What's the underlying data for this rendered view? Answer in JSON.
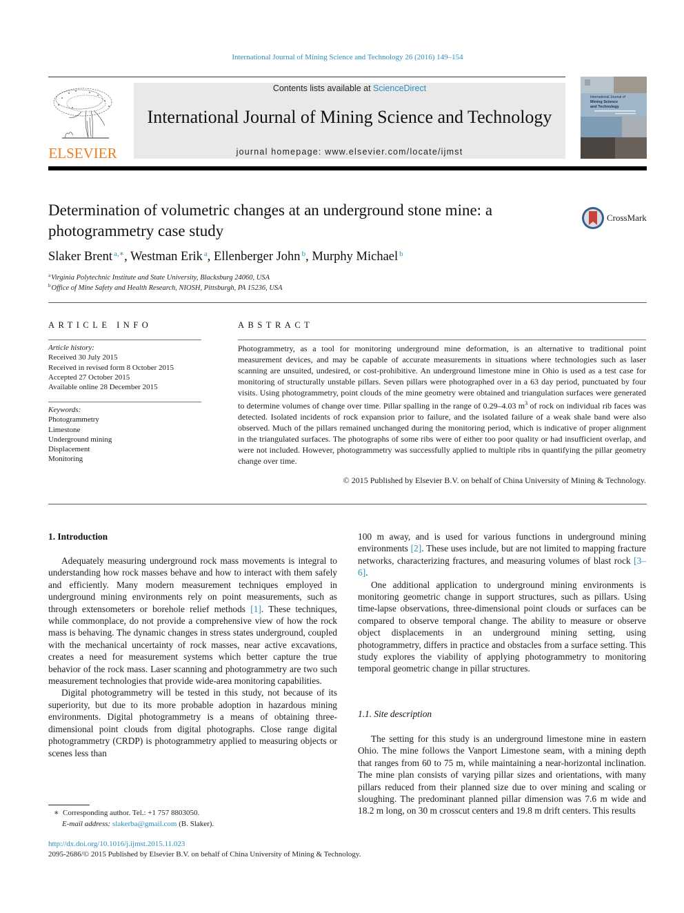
{
  "header": {
    "running_head": "International Journal of Mining Science and Technology 26 (2016) 149–154",
    "publisher": "ELSEVIER",
    "contents_prefix": "Contents lists available at ",
    "contents_link": "ScienceDirect",
    "journal_title": "International Journal of Mining Science and Technology",
    "homepage": "journal homepage: www.elsevier.com/locate/ijmst",
    "cover_title_lines": [
      "International Journal of",
      "Mining Science",
      "and Technology"
    ]
  },
  "article": {
    "title_line1": "Determination of volumetric changes at an underground stone mine: a",
    "title_line2": "photogrammetry case study",
    "crossmark_label": "CrossMark",
    "authors": [
      {
        "name": "Slaker Brent",
        "sup": "a,∗",
        "sep": ", "
      },
      {
        "name": "Westman Erik",
        "sup": "a",
        "sep": ", "
      },
      {
        "name": "Ellenberger John",
        "sup": "b",
        "sep": ", "
      },
      {
        "name": "Murphy Michael",
        "sup": "b",
        "sep": ""
      }
    ],
    "affiliations": [
      {
        "mark": "a",
        "text": "Virginia Polytechnic Institute and State University, Blacksburg 24060, USA"
      },
      {
        "mark": "b",
        "text": "Office of Mine Safety and Health Research, NIOSH, Pittsburgh, PA 15236, USA"
      }
    ]
  },
  "article_info": {
    "heading": "ARTICLE INFO",
    "history_label": "Article history:",
    "history": [
      "Received 30 July 2015",
      "Received in revised form 8 October 2015",
      "Accepted 27 October 2015",
      "Available online 28 December 2015"
    ],
    "keywords_label": "Keywords:",
    "keywords": [
      "Photogrammetry",
      "Limestone",
      "Underground mining",
      "Displacement",
      "Monitoring"
    ]
  },
  "abstract": {
    "heading": "ABSTRACT",
    "text_before_sup": "Photogrammetry, as a tool for monitoring underground mine deformation, is an alternative to traditional point measurement devices, and may be capable of accurate measurements in situations where technologies such as laser scanning are unsuited, undesired, or cost-prohibitive. An underground limestone mine in Ohio is used as a test case for monitoring of structurally unstable pillars. Seven pillars were photographed over in a 63 day period, punctuated by four visits. Using photogrammetry, point clouds of the mine geometry were obtained and triangulation surfaces were generated to determine volumes of change over time. Pillar spalling in the range of 0.29–4.03 m",
    "sup": "3",
    "text_after_sup": " of rock on individual rib faces was detected. Isolated incidents of rock expansion prior to failure, and the isolated failure of a weak shale band were also observed. Much of the pillars remained unchanged during the monitoring period, which is indicative of proper alignment in the triangulated surfaces. The photographs of some ribs were of either too poor quality or had insufficient overlap, and were not included. However, photogrammetry was successfully applied to multiple ribs in quantifying the pillar geometry change over time.",
    "copyright": "© 2015 Published by Elsevier B.V. on behalf of China University of Mining & Technology."
  },
  "body": {
    "section1_heading": "1. Introduction",
    "p1_a": "Adequately measuring underground rock mass movements is integral to understanding how rock masses behave and how to interact with them safely and efficiently. Many modern measurement techniques employed in underground mining environments rely on point measurements, such as through extensometers or borehole relief methods ",
    "p1_ref": "[1]",
    "p1_b": ". These techniques, while commonplace, do not provide a comprehensive view of how the rock mass is behaving. The dynamic changes in stress states underground, coupled with the mechanical uncertainty of rock masses, near active excavations, creates a need for measurement systems which better capture the true behavior of the rock mass. Laser scanning and photogrammetry are two such measurement technologies that provide wide-area monitoring capabilities.",
    "p2": "Digital photogrammetry will be tested in this study, not because of its superiority, but due to its more probable adoption in hazardous mining environments. Digital photogrammetry is a means of obtaining three-dimensional point clouds from digital photographs. Close range digital photogrammetry (CRDP) is photogrammetry applied to measuring objects or scenes less than",
    "p3_a": "100 m away, and is used for various functions in underground mining environments ",
    "p3_ref1": "[2]",
    "p3_b": ". These uses include, but are not limited to mapping fracture networks, characterizing fractures, and measuring volumes of blast rock ",
    "p3_ref2": "[3–6]",
    "p3_c": ".",
    "p4": "One additional application to underground mining environments is monitoring geometric change in support structures, such as pillars. Using time-lapse observations, three-dimensional point clouds or surfaces can be compared to observe temporal change. The ability to measure or observe object displacements in an underground mining setting, using photogrammetry, differs in practice and obstacles from a surface setting. This study explores the viability of applying photogrammetry to monitoring temporal geometric change in pillar structures.",
    "section11_heading": "1.1. Site description",
    "p5": "The setting for this study is an underground limestone mine in eastern Ohio. The mine follows the Vanport Limestone seam, with a mining depth that ranges from 60 to 75 m, while maintaining a near-horizontal inclination. The mine plan consists of varying pillar sizes and orientations, with many pillars reduced from their planned size due to over mining and scaling or sloughing. The predominant planned pillar dimension was 7.6 m wide and 18.2 m long, on 30 m crosscut centers and 19.8 m drift centers. This results"
  },
  "footnote": {
    "mark": "∗",
    "corresponding": "Corresponding author. Tel.: +1 757 8803050.",
    "email_label": "E-mail address: ",
    "email": "slakerba@gmail.com",
    "email_suffix": " (B. Slaker)."
  },
  "footer": {
    "doi": "http://dx.doi.org/10.1016/j.ijmst.2015.11.023",
    "issn_line": "2095-2686/© 2015 Published by Elsevier B.V. on behalf of China University of Mining & Technology."
  },
  "colors": {
    "link": "#2a8fbf",
    "elsevier_orange": "#f07d1e",
    "banner_gray": "#e9e9e9"
  }
}
